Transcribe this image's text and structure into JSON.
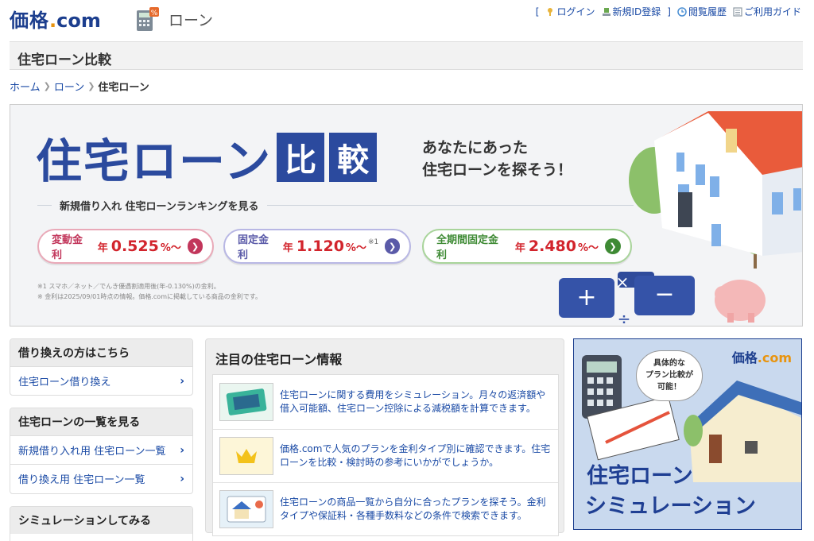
{
  "header": {
    "logo": {
      "kakaku": "価格",
      "dot": ".",
      "com": "com"
    },
    "section": "ローン",
    "util": {
      "open_bracket": "[",
      "login": "ログイン",
      "register": "新規ID登録",
      "close_bracket": "]",
      "history": "閲覧履歴",
      "guide": "ご利用ガイド"
    }
  },
  "page": {
    "title": "住宅ローン比較",
    "breadcrumb": [
      "ホーム",
      "ローン",
      "住宅ローン"
    ]
  },
  "hero": {
    "title_main": "住宅ローン",
    "title_box1": "比",
    "title_box2": "較",
    "subtitle_line1": "あなたにあった",
    "subtitle_line2": "住宅ローンを探そう！",
    "ranking_label": "新規借り入れ 住宅ローンランキングを見る",
    "rates": [
      {
        "label": "変動金利",
        "year": "年",
        "value": "0.525",
        "unit": "%〜",
        "note": ""
      },
      {
        "label": "固定金利",
        "year": "年",
        "value": "1.120",
        "unit": "%〜",
        "note": "※1"
      },
      {
        "label": "全期間固定金利",
        "year": "年",
        "value": "2.480",
        "unit": "%〜",
        "note": ""
      }
    ],
    "footnote1": "※1 スマホ／ネット／でんき優遇割適用後(年-0.130%)の金利。",
    "footnote2": "※ 金利は2025/09/01時点の情報。価格.comに掲載している商品の金利です。"
  },
  "sidebar": {
    "boxes": [
      {
        "heading": "借り換えの方はこちら",
        "items": [
          "住宅ローン借り換え"
        ]
      },
      {
        "heading": "住宅ローンの一覧を見る",
        "items": [
          "新規借り入れ用 住宅ローン一覧",
          "借り換え用 住宅ローン一覧"
        ]
      },
      {
        "heading": "シミュレーションしてみる",
        "items": []
      }
    ]
  },
  "featured": {
    "heading": "注目の住宅ローン情報",
    "items": [
      {
        "text": "住宅ローンに関する費用をシミュレーション。月々の返済額や借入可能額、住宅ローン控除による減税額を計算できます。"
      },
      {
        "text": "価格.comで人気のプランを金利タイプ別に確認できます。住宅ローンを比較・検討時の参考にいかがでしょうか。"
      },
      {
        "text": "住宅ローンの商品一覧から自分に合ったプランを探そう。金利タイプや保証料・各種手数料などの条件で検索できます。"
      }
    ]
  },
  "ad": {
    "logo_main": "価格",
    "logo_sub": ".com",
    "bubble_line1": "具体的な",
    "bubble_line2": "プラン比較が",
    "bubble_line3": "可能！",
    "title_line1": "住宅ローン",
    "title_line2": "シミュレーション"
  },
  "colors": {
    "brand": "#1c3e8e",
    "link": "#1a4aa5",
    "rate": "#d2242c"
  }
}
